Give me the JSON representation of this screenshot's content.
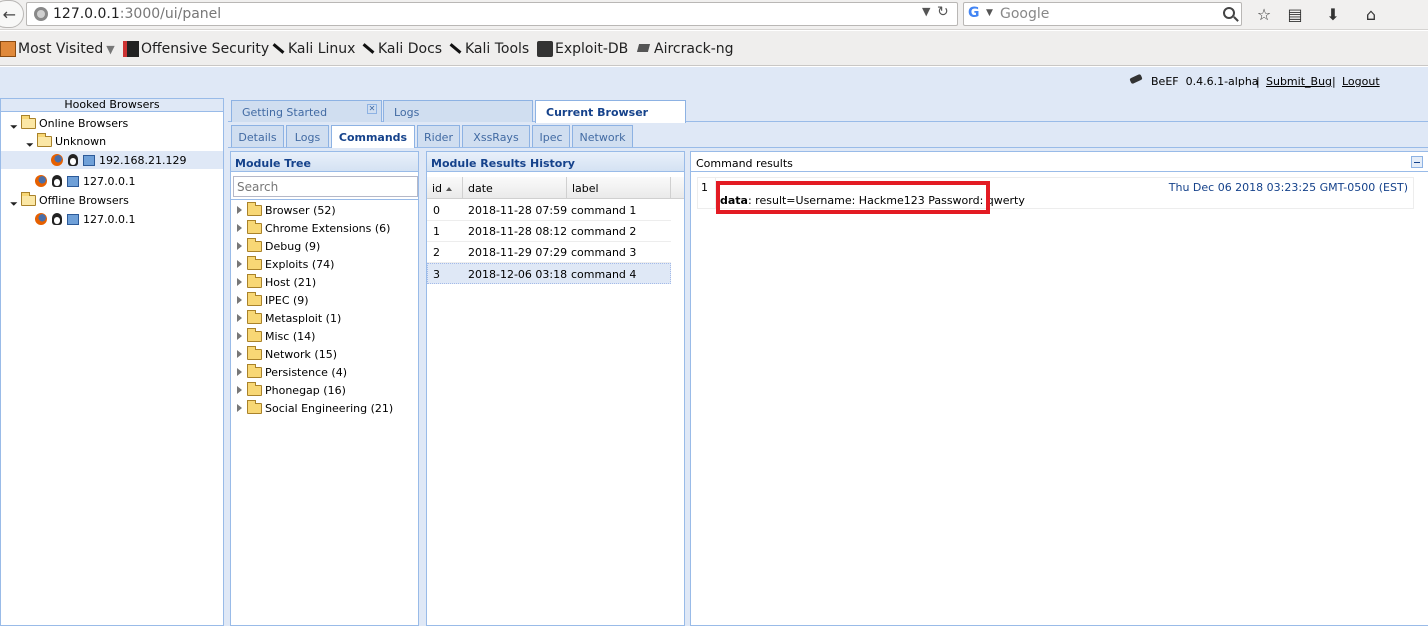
{
  "browser": {
    "url_host": "127.0.0.1",
    "url_path": ":3000/ui/panel",
    "search_placeholder": "Google",
    "bookmarks": [
      {
        "label": "Most Visited",
        "icon": "folder-icon"
      },
      {
        "label": "Offensive Security",
        "icon": "offensive-security-icon"
      },
      {
        "label": "Kali Linux",
        "icon": "kali-dragon-icon"
      },
      {
        "label": "Kali Docs",
        "icon": "kali-dragon-icon"
      },
      {
        "label": "Kali Tools",
        "icon": "kali-dragon-icon"
      },
      {
        "label": "Exploit-DB",
        "icon": "exploit-db-icon"
      },
      {
        "label": "Aircrack-ng",
        "icon": "aircrack-icon"
      }
    ]
  },
  "header": {
    "app": "BeEF",
    "version": "0.4.6.1-alpha",
    "separator": "|",
    "submit_bug": "Submit_Bug",
    "logout": "Logout"
  },
  "hooked": {
    "title": "Hooked Browsers",
    "online_label": "Online Browsers",
    "unknown_label": "Unknown",
    "online_ip_1": "192.168.21.129",
    "online_ip_2": "127.0.0.1",
    "offline_label": "Offline Browsers",
    "offline_ip_1": "127.0.0.1"
  },
  "main_tabs": [
    "Getting Started",
    "Logs",
    "Current Browser"
  ],
  "sub_tabs": [
    "Details",
    "Logs",
    "Commands",
    "Rider",
    "XssRays",
    "Ipec",
    "Network"
  ],
  "module_tree": {
    "title": "Module Tree",
    "search_placeholder": "Search",
    "items": [
      "Browser (52)",
      "Chrome Extensions (6)",
      "Debug (9)",
      "Exploits (74)",
      "Host (21)",
      "IPEC (9)",
      "Metasploit (1)",
      "Misc (14)",
      "Network (15)",
      "Persistence (4)",
      "Phonegap (16)",
      "Social Engineering (21)"
    ]
  },
  "history": {
    "title": "Module Results History",
    "columns": [
      "id",
      "date",
      "label"
    ],
    "rows": [
      [
        "0",
        "2018-11-28 07:59",
        "command 1"
      ],
      [
        "1",
        "2018-11-28 08:12",
        "command 2"
      ],
      [
        "2",
        "2018-11-29 07:29",
        "command 3"
      ],
      [
        "3",
        "2018-12-06 03:18",
        "command 4"
      ]
    ]
  },
  "results": {
    "title": "Command results",
    "row_number": "1",
    "timestamp": "Thu Dec 06 2018 03:23:25 GMT-0500 (EST)",
    "data_key": "data",
    "data_value": ": result=Username: Hackme123 Password: qwerty"
  },
  "colors": {
    "panel_bg": "#dfe8f6",
    "border": "#99bbe8",
    "header_text": "#15428b",
    "highlight": "#e31b23"
  }
}
